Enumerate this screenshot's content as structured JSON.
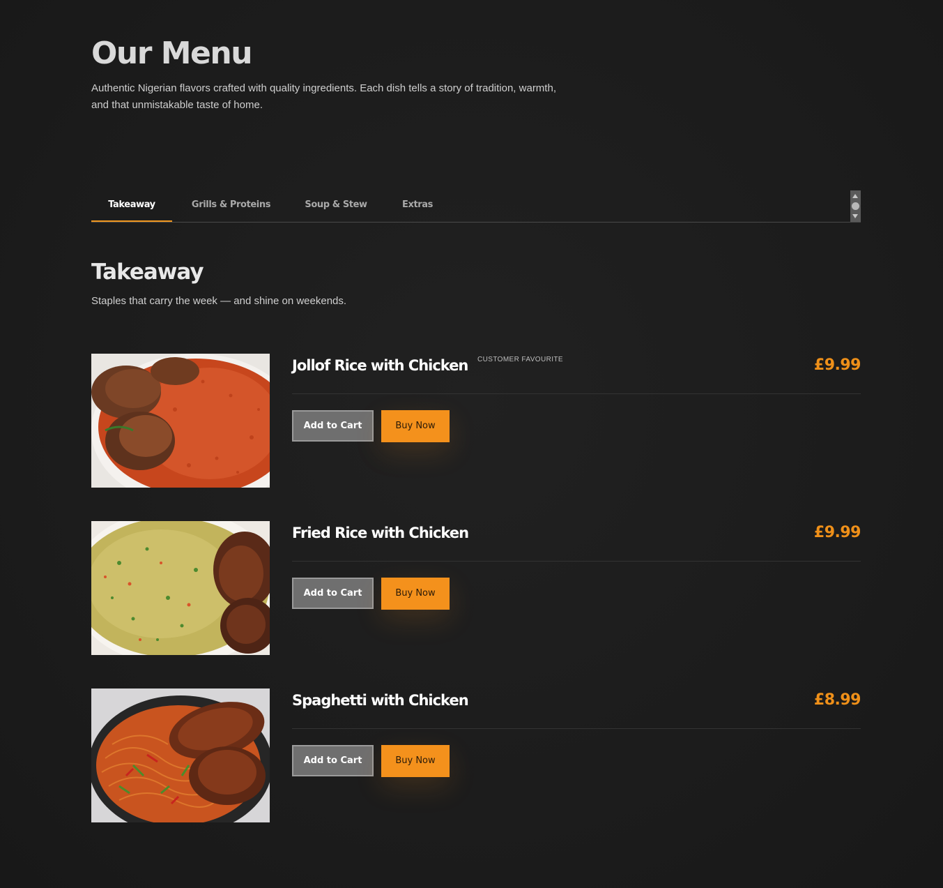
{
  "header": {
    "title": "Our Menu",
    "intro": "Authentic Nigerian flavors crafted with quality ingredients. Each dish tells a story of tradition, warmth, and that unmistakable taste of home."
  },
  "tabs": [
    {
      "label": "Takeaway",
      "active": true
    },
    {
      "label": "Grills & Proteins",
      "active": false
    },
    {
      "label": "Soup & Stew",
      "active": false
    },
    {
      "label": "Extras",
      "active": false
    }
  ],
  "section": {
    "title": "Takeaway",
    "subtitle": "Staples that carry the week — and shine on weekends."
  },
  "items": [
    {
      "name": "Jollof Rice with Chicken",
      "badge": "CUSTOMER FAVOURITE",
      "price": "£9.99",
      "add_label": "Add to Cart",
      "buy_label": "Buy Now",
      "image_icon": "jollof-rice-photo"
    },
    {
      "name": "Fried Rice with Chicken",
      "badge": "",
      "price": "£9.99",
      "add_label": "Add to Cart",
      "buy_label": "Buy Now",
      "image_icon": "fried-rice-photo"
    },
    {
      "name": "Spaghetti with Chicken",
      "badge": "",
      "price": "£8.99",
      "add_label": "Add to Cart",
      "buy_label": "Buy Now",
      "image_icon": "spaghetti-photo"
    }
  ],
  "colors": {
    "accent": "#f4911c",
    "background": "#1c1c1c",
    "price": "#ef9019"
  }
}
